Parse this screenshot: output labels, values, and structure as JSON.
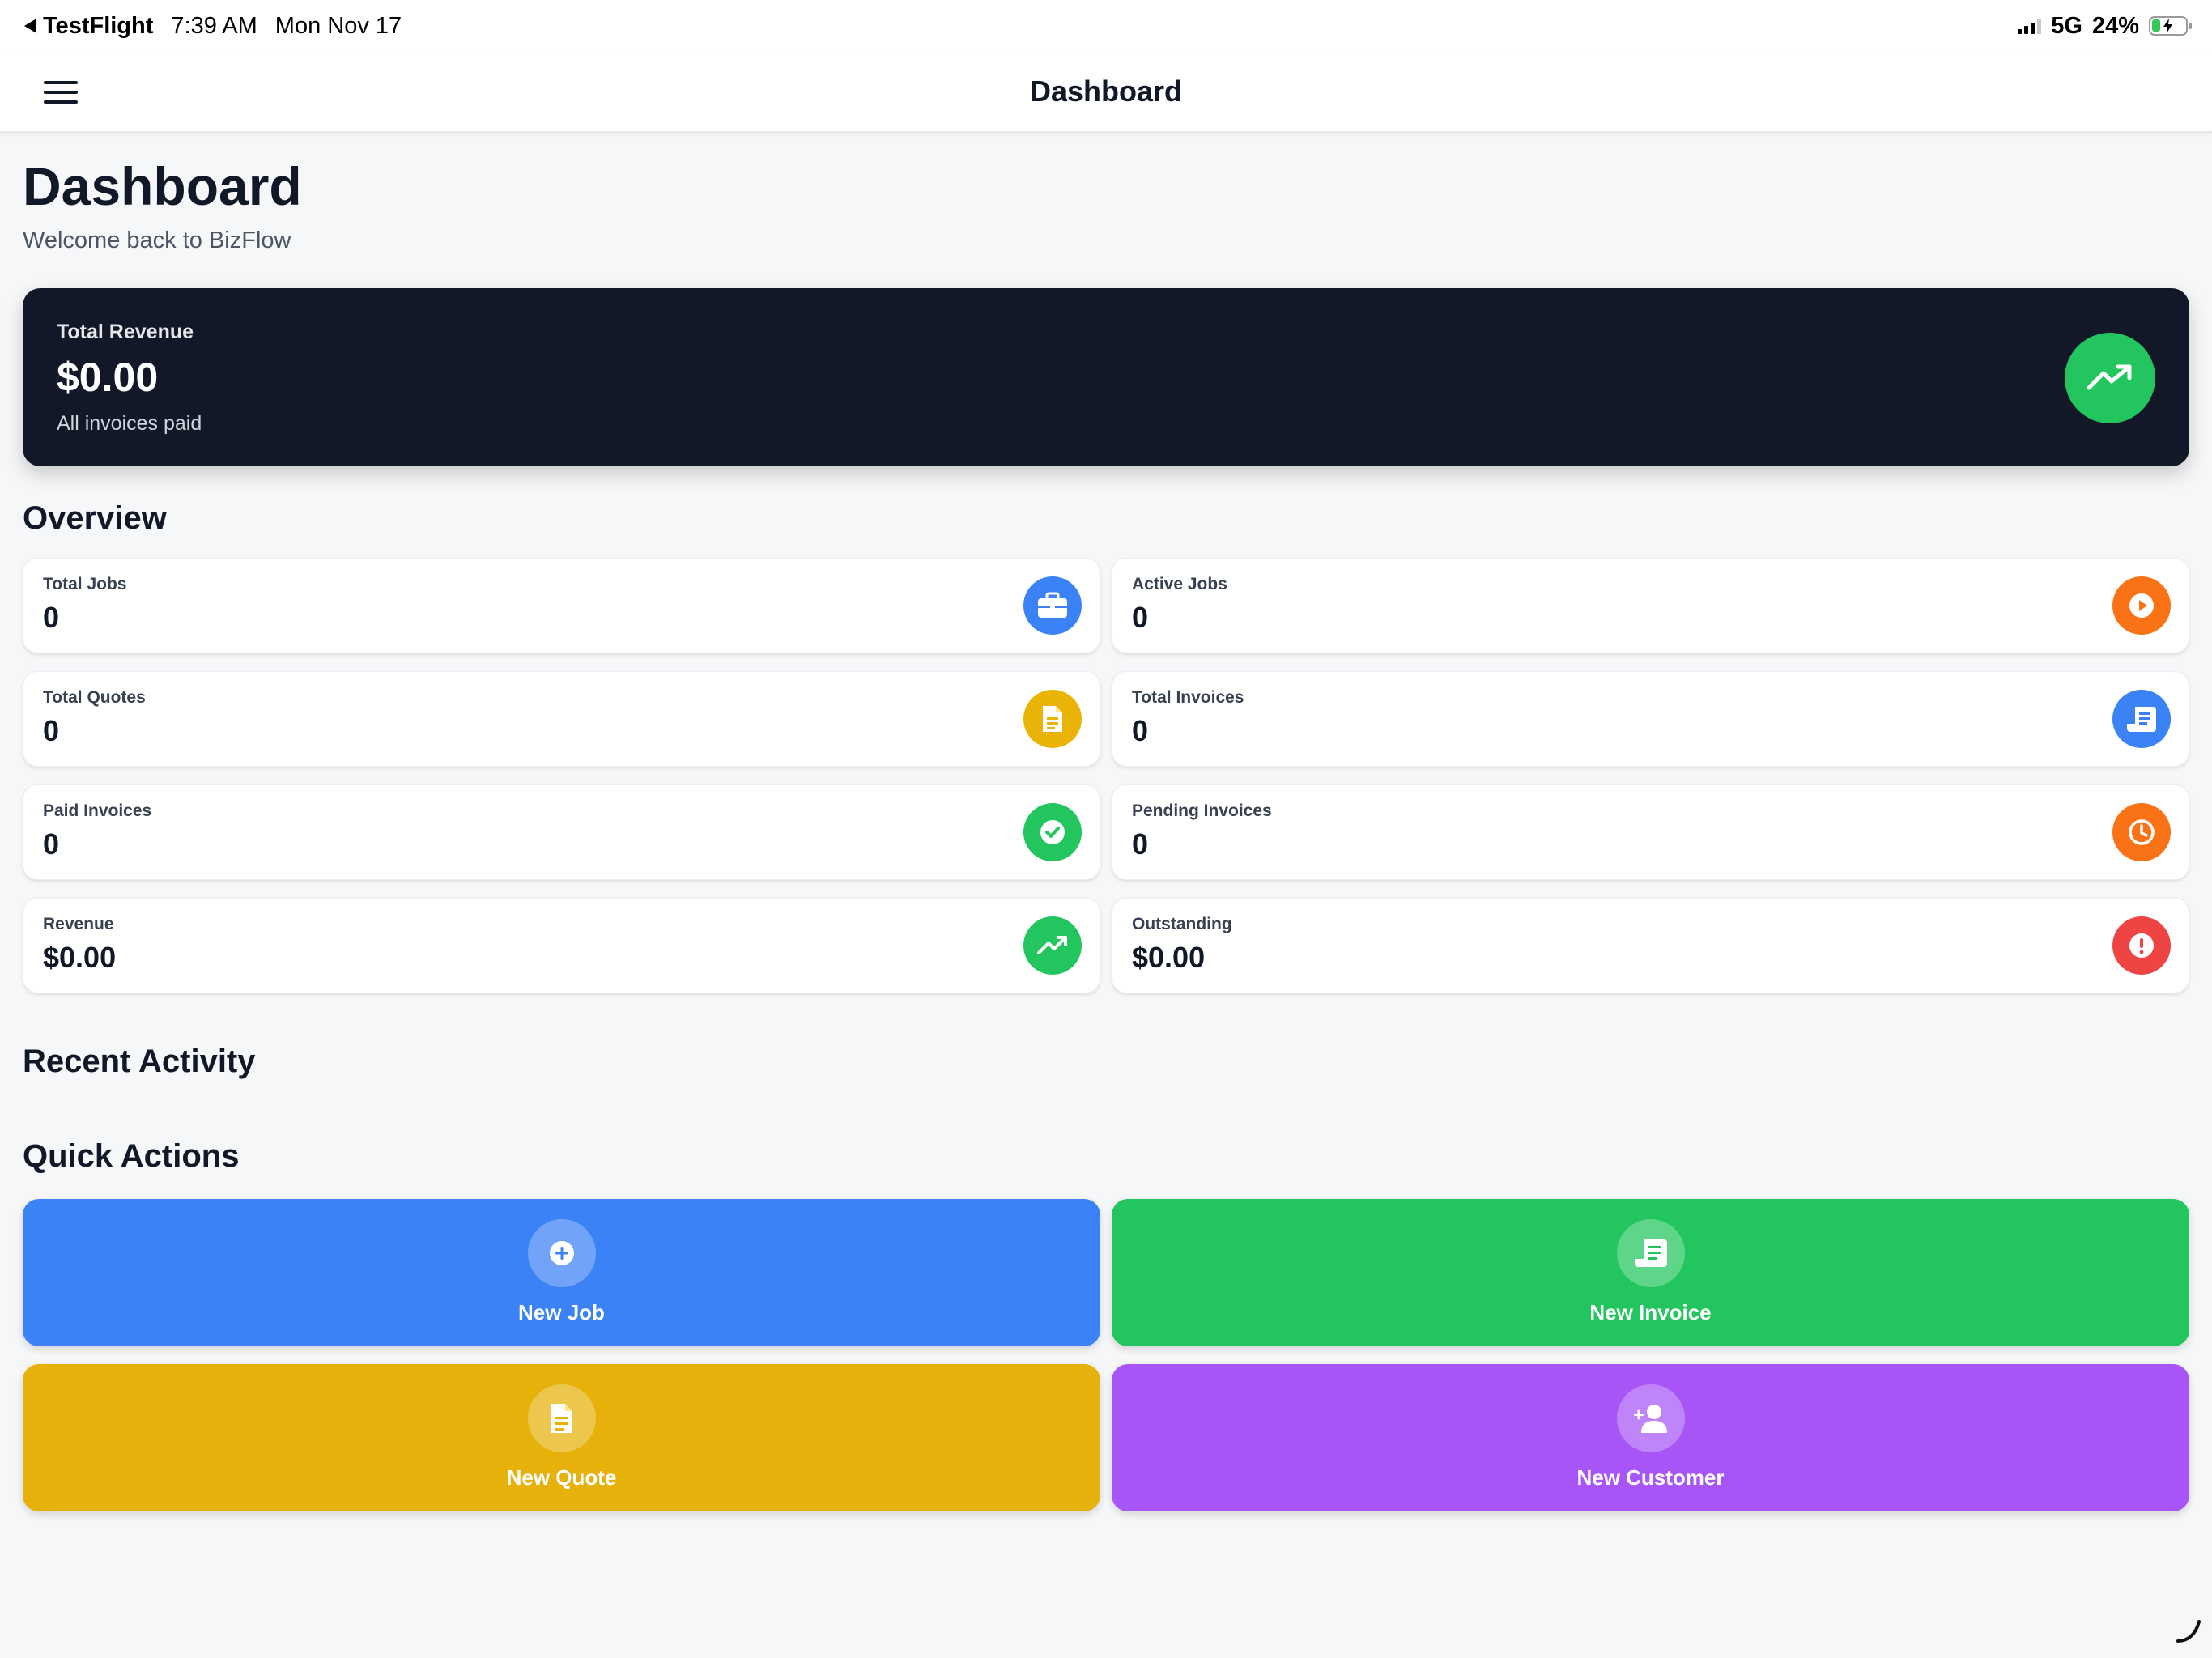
{
  "status_bar": {
    "back_app": "TestFlight",
    "time": "7:39 AM",
    "date": "Mon Nov 17",
    "network": "5G",
    "battery": "24%"
  },
  "nav": {
    "title": "Dashboard"
  },
  "header": {
    "title": "Dashboard",
    "subtitle": "Welcome back to BizFlow"
  },
  "revenue_card": {
    "label": "Total Revenue",
    "value": "$0.00",
    "subtitle": "All invoices paid",
    "icon": "trending-up-icon",
    "background": "#121828",
    "icon_color": "#22c55e"
  },
  "overview": {
    "title": "Overview",
    "stats": [
      {
        "label": "Total Jobs",
        "value": "0",
        "icon": "briefcase-icon",
        "color": "#3b82f6"
      },
      {
        "label": "Active Jobs",
        "value": "0",
        "icon": "play-circle-icon",
        "color": "#f97316"
      },
      {
        "label": "Total Quotes",
        "value": "0",
        "icon": "document-icon",
        "color": "#eab308"
      },
      {
        "label": "Total Invoices",
        "value": "0",
        "icon": "receipt-icon",
        "color": "#3b82f6"
      },
      {
        "label": "Paid Invoices",
        "value": "0",
        "icon": "check-circle-icon",
        "color": "#22c55e"
      },
      {
        "label": "Pending Invoices",
        "value": "0",
        "icon": "clock-icon",
        "color": "#f97316"
      },
      {
        "label": "Revenue",
        "value": "$0.00",
        "icon": "trending-up-icon",
        "color": "#22c55e"
      },
      {
        "label": "Outstanding",
        "value": "$0.00",
        "icon": "alert-icon",
        "color": "#ef4444"
      }
    ]
  },
  "recent_activity": {
    "title": "Recent Activity"
  },
  "quick_actions": {
    "title": "Quick Actions",
    "items": [
      {
        "label": "New Job",
        "icon": "plus-circle-icon",
        "color": "#3b82f6"
      },
      {
        "label": "New Invoice",
        "icon": "receipt-icon",
        "color": "#22c55e"
      },
      {
        "label": "New Quote",
        "icon": "document-icon",
        "color": "#e6b10a"
      },
      {
        "label": "New Customer",
        "icon": "person-add-icon",
        "color": "#a855f7"
      }
    ]
  }
}
